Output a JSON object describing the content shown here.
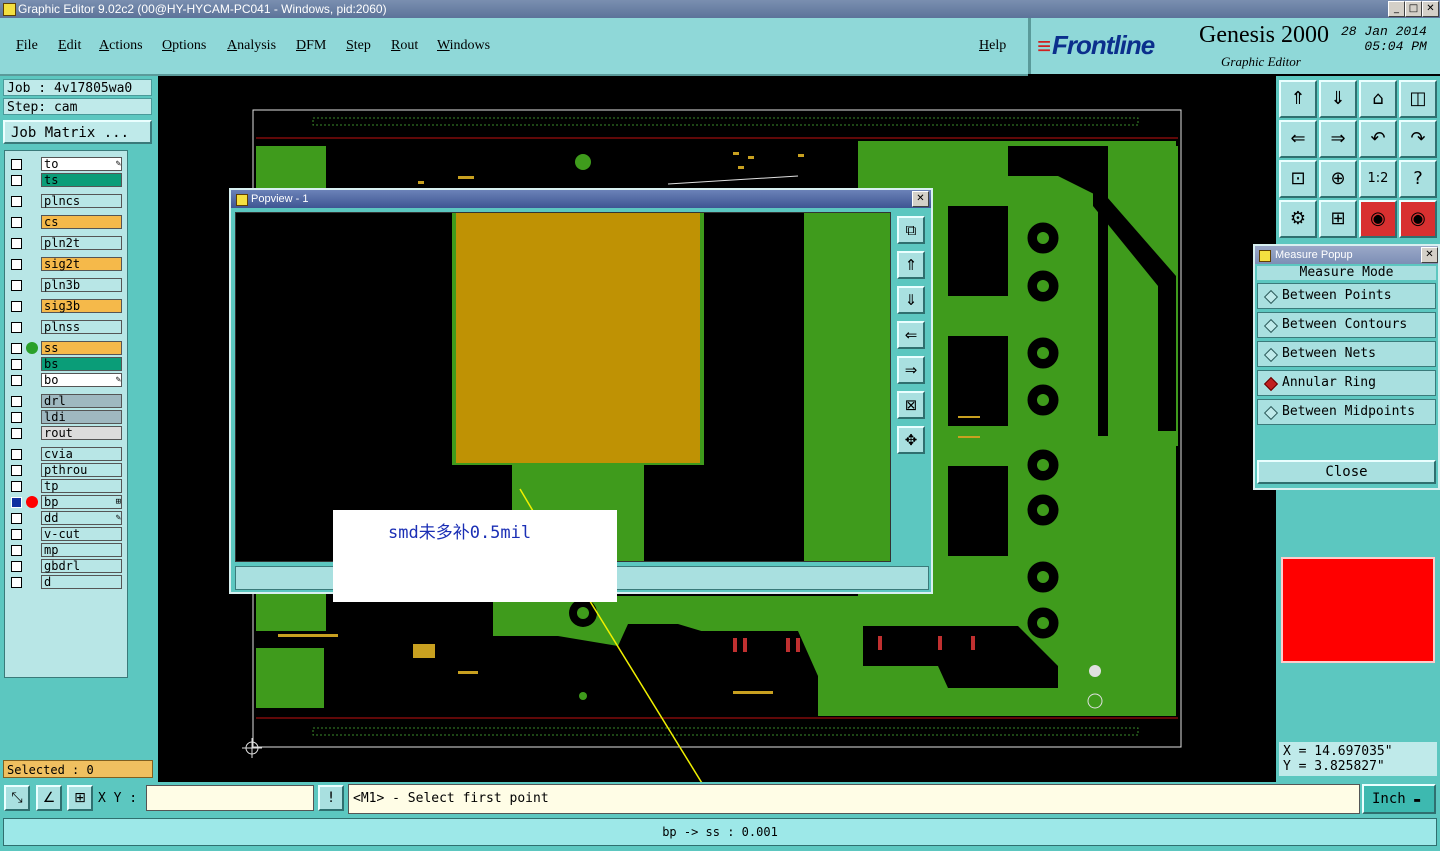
{
  "window": {
    "title": "Graphic Editor 9.02c2 (00@HY-HYCAM-PC041 - Windows, pid:2060)",
    "controls": [
      "_",
      "□",
      "✕"
    ]
  },
  "menu": {
    "items": [
      "File",
      "Edit",
      "Actions",
      "Options",
      "Analysis",
      "DFM",
      "Step",
      "Rout",
      "Windows"
    ],
    "help": "Help"
  },
  "brand": {
    "logo": "Frontline",
    "product": "Genesis 2000",
    "subtitle": "Graphic Editor",
    "date": "28 Jan 2014",
    "time": "05:04 PM"
  },
  "job": {
    "job_label": "Job : 4v17805wa0",
    "step_label": "Step: cam",
    "matrix_button": "Job Matrix ..."
  },
  "layers": [
    {
      "name": "to",
      "color": "#ffffff",
      "mark": "edit"
    },
    {
      "name": "ts",
      "color": "#0a9d78"
    },
    {
      "name": "plncs",
      "color": "#b8e6e6"
    },
    {
      "name": "cs",
      "color": "#f5b94a"
    },
    {
      "name": "pln2t",
      "color": "#b8e6e6"
    },
    {
      "name": "sig2t",
      "color": "#f5b94a"
    },
    {
      "name": "pln3b",
      "color": "#b8e6e6"
    },
    {
      "name": "sig3b",
      "color": "#f5b94a"
    },
    {
      "name": "plnss",
      "color": "#b8e6e6"
    },
    {
      "name": "ss",
      "color": "#f5b94a",
      "dot": "#2aa02a"
    },
    {
      "name": "bs",
      "color": "#0a9d78"
    },
    {
      "name": "bo",
      "color": "#ffffff",
      "mark": "edit"
    },
    {
      "name": "drl",
      "color": "#9fb8c0"
    },
    {
      "name": "ldi",
      "color": "#9fb8c0"
    },
    {
      "name": "rout",
      "color": "#dcdcdc"
    },
    {
      "name": "cvia",
      "color": "#b8e6e6"
    },
    {
      "name": "pthrou",
      "color": "#b8e6e6"
    },
    {
      "name": "tp",
      "color": "#b8e6e6"
    },
    {
      "name": "bp",
      "color": "#b8e6e6",
      "dot": "#ff0000",
      "active": true,
      "mark": "grid"
    },
    {
      "name": "dd",
      "color": "#b8e6e6",
      "mark": "edit"
    },
    {
      "name": "v-cut",
      "color": "#b8e6e6"
    },
    {
      "name": "mp",
      "color": "#b8e6e6"
    },
    {
      "name": "gbdrl",
      "color": "#b8e6e6"
    },
    {
      "name": "d",
      "color": "#b8e6e6"
    }
  ],
  "selected": "Selected : 0",
  "popview": {
    "title": "Popview - 1",
    "tools": [
      "zoom-home-icon",
      "pan-up-icon",
      "pan-down-icon",
      "pan-left-icon",
      "pan-right-icon",
      "zoom-fit-icon",
      "zoom-in-icon"
    ]
  },
  "annotation": "smd未多补0.5mil",
  "measure": {
    "title": "Measure Popup",
    "header": "Measure Mode",
    "options": [
      {
        "label": "Between Points",
        "selected": false
      },
      {
        "label": "Between Contours",
        "selected": false
      },
      {
        "label": "Between Nets",
        "selected": false
      },
      {
        "label": "Annular Ring",
        "selected": true
      },
      {
        "label": "Between Midpoints",
        "selected": false
      }
    ],
    "close": "Close"
  },
  "right_tools": [
    "⇑",
    "⇓",
    "⌂",
    "◫",
    "⇐",
    "⇒",
    "↶",
    "↷",
    "⊡",
    "⊕",
    "1:2",
    "?",
    "⚙",
    "⊞",
    "◉",
    "◉"
  ],
  "coords": {
    "x": "X = 14.697035\"",
    "y": "Y = 3.825827\""
  },
  "xy": {
    "label": "X Y :",
    "value": ""
  },
  "prompt": "<M1> - Select first point",
  "unit": "Inch",
  "status": "bp -> ss : 0.001"
}
